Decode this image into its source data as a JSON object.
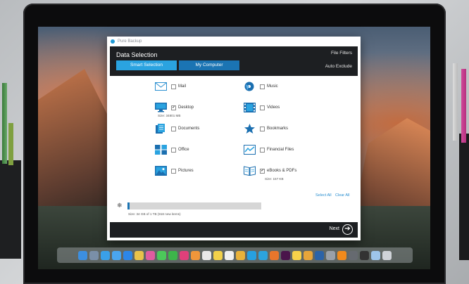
{
  "app": {
    "window_title": "Pure Backup",
    "header_title": "Data Selection",
    "file_filters": "File Filters",
    "auto_exclude": "Auto Exclude",
    "tabs": [
      {
        "label": "Smart Selection",
        "active": true
      },
      {
        "label": "My Computer",
        "active": false
      }
    ],
    "items": [
      {
        "id": "mail",
        "label": "Mail",
        "checked": false,
        "icon": "envelope-icon",
        "sub": ""
      },
      {
        "id": "music",
        "label": "Music",
        "checked": false,
        "icon": "music-disc-icon",
        "sub": ""
      },
      {
        "id": "desktop",
        "label": "Desktop",
        "checked": true,
        "icon": "monitor-icon",
        "sub": "Size: 34801 MB"
      },
      {
        "id": "videos",
        "label": "Videos",
        "checked": false,
        "icon": "film-icon",
        "sub": ""
      },
      {
        "id": "documents",
        "label": "Documents",
        "checked": false,
        "icon": "documents-icon",
        "sub": ""
      },
      {
        "id": "bookmarks",
        "label": "Bookmarks",
        "checked": false,
        "icon": "star-icon",
        "sub": ""
      },
      {
        "id": "office",
        "label": "Office",
        "checked": false,
        "icon": "office-icon",
        "sub": ""
      },
      {
        "id": "financial",
        "label": "Financial Files",
        "checked": false,
        "icon": "chart-line-icon",
        "sub": ""
      },
      {
        "id": "pictures",
        "label": "Pictures",
        "checked": false,
        "icon": "picture-icon",
        "sub": ""
      },
      {
        "id": "ebooks",
        "label": "eBooks & PDFs",
        "checked": true,
        "icon": "book-icon",
        "sub": "Size: 157 KB"
      }
    ],
    "select_all": "Select All",
    "clear_all": "Clear All",
    "progress_text": "Size: 34 GB of 1 TB (918 new items)",
    "progress_fraction": 0.015,
    "next_label": "Next",
    "accent_color": "#2aa3e0",
    "dark_color": "#1d1f22"
  },
  "dock": {
    "icons": [
      "finder",
      "launchpad",
      "safari",
      "mail",
      "appstore",
      "maps",
      "photos",
      "messages",
      "facetime",
      "itunes",
      "ibooks",
      "calendar",
      "notes",
      "reminders",
      "chrome",
      "skype",
      "telegram",
      "firefox",
      "slack",
      "notes2",
      "sketch",
      "photoshop",
      "settings",
      "vlc",
      "activity",
      "terminal",
      "finder2",
      "trash"
    ],
    "colors": [
      "#3c8fe0",
      "#7a8fa8",
      "#3aa0e8",
      "#4aa6f0",
      "#2c86e8",
      "#e8c24a",
      "#e05ca0",
      "#4cc85a",
      "#3db54a",
      "#e0407a",
      "#f0963a",
      "#e8e8e8",
      "#f2d14a",
      "#f0f0f0",
      "#e9b23a",
      "#27a0e0",
      "#2ca3dd",
      "#e8762c",
      "#4a154b",
      "#f7d24a",
      "#e7a53a",
      "#2b63a8",
      "#9aa0a8",
      "#f08a1c",
      "#666a70",
      "#333333",
      "#9ec5ea",
      "#cfd3d8"
    ]
  }
}
